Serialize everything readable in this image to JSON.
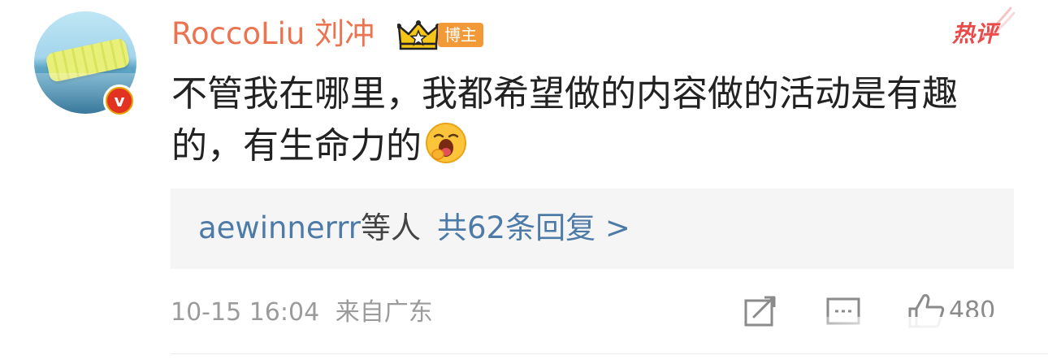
{
  "user": {
    "name": "RoccoLiu 刘冲",
    "badge_label": "博主",
    "verified_label": "v",
    "crown_icon": "crown-icon",
    "badge_color": "#f39a38",
    "name_color": "#eb7350"
  },
  "hot_label": "热评",
  "comment_text": "不管我在哪里，我都希望做的内容做的活动是有趣的，有生命力的",
  "emoji": "yawn-emoji",
  "replies": {
    "users": "aewinnerrr",
    "suffix": "等人",
    "count_label": "共62条回复 >"
  },
  "footer": {
    "time": "10-15 16:04",
    "location": "来自广东",
    "like_count": "480"
  },
  "colors": {
    "link": "#4e7aa8",
    "hot": "#e94b4b",
    "muted": "#9b9b9b"
  }
}
